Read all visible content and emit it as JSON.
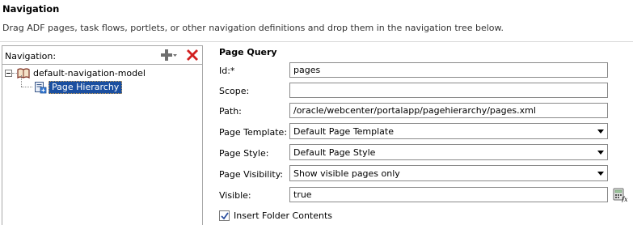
{
  "section": {
    "title": "Navigation",
    "description": "Drag ADF pages, task flows, portlets, or other navigation definitions and drop them in the navigation tree below."
  },
  "navigation_panel": {
    "label": "Navigation:",
    "add_icon": "add-plus-icon",
    "delete_icon": "delete-x-icon",
    "tree": {
      "root": {
        "label": "default-navigation-model",
        "icon": "book-icon",
        "expanded": true
      },
      "children": [
        {
          "label": "Page Hierarchy",
          "icon": "page-hierarchy-icon",
          "selected": true
        }
      ]
    }
  },
  "form": {
    "title": "Page Query",
    "fields": {
      "id": {
        "label": "Id:*",
        "value": "pages"
      },
      "scope": {
        "label": "Scope:",
        "value": ""
      },
      "path": {
        "label": "Path:",
        "value": "/oracle/webcenter/portalapp/pagehierarchy/pages.xml"
      },
      "page_template": {
        "label": "Page Template:",
        "value": "Default Page Template"
      },
      "page_style": {
        "label": "Page Style:",
        "value": "Default Page Style"
      },
      "page_visibility": {
        "label": "Page Visibility:",
        "value": "Show visible pages only"
      },
      "visible": {
        "label": "Visible:",
        "value": "true",
        "icon": "expression-builder-icon"
      }
    },
    "insert_folder_contents": {
      "label": "Insert Folder Contents",
      "checked": true
    }
  },
  "colors": {
    "selection_bg": "#1b4fa0",
    "delete_red": "#d21f1f",
    "add_gray": "#6f6f6f"
  }
}
